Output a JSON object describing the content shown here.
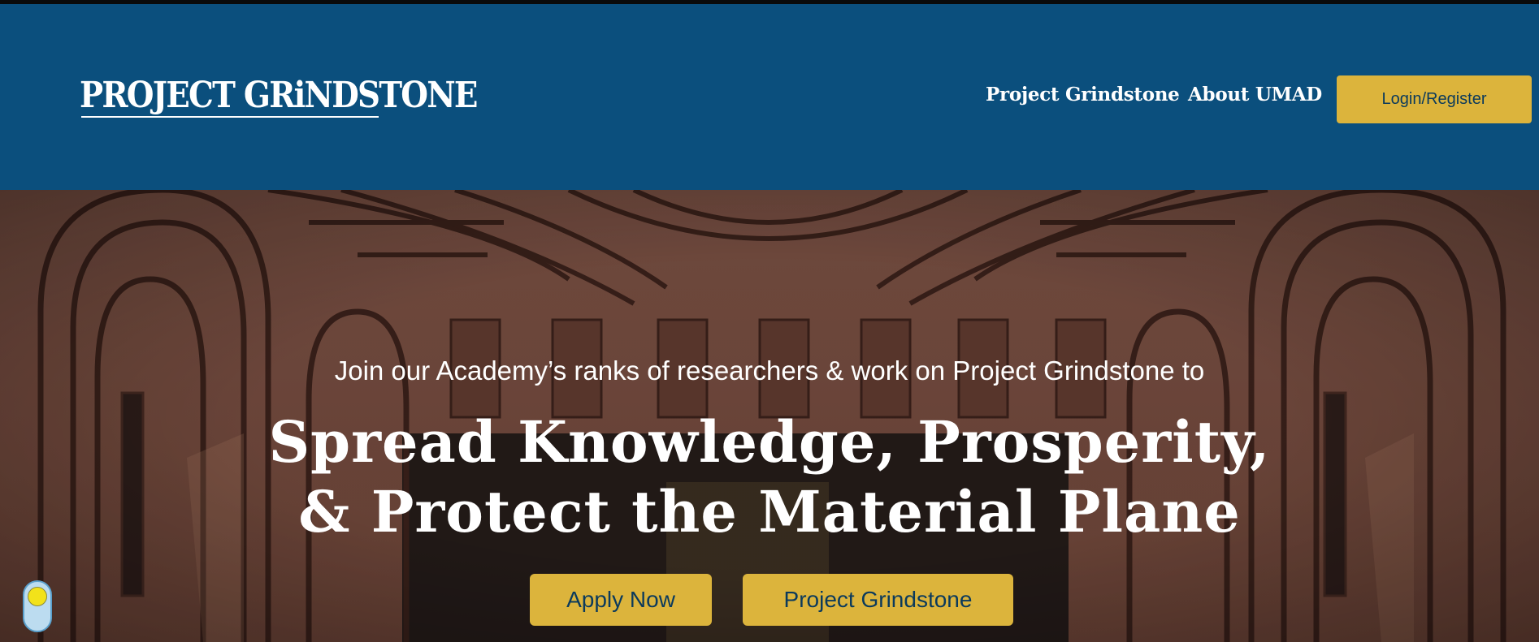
{
  "colors": {
    "header_bg": "#0b4f7d",
    "accent_button": "#dcb43c",
    "button_text": "#0b3a5c"
  },
  "header": {
    "logo_text": "PROJECT GRiNDSTONE",
    "nav": {
      "project_grindstone": "Project Grindstone",
      "about_umad": "About UMAD"
    },
    "login_label": "Login/Register"
  },
  "hero": {
    "tagline": "Join our Academy’s ranks of researchers & work on Project Grindstone to",
    "headline_line1": "Spread Knowledge, Prosperity,",
    "headline_line2": "& Protect the Material Plane",
    "apply_label": "Apply Now",
    "project_label": "Project Grindstone",
    "background_icon": "great-hall-illustration"
  },
  "widgets": {
    "toggle_icon": "theme-toggle-icon"
  }
}
